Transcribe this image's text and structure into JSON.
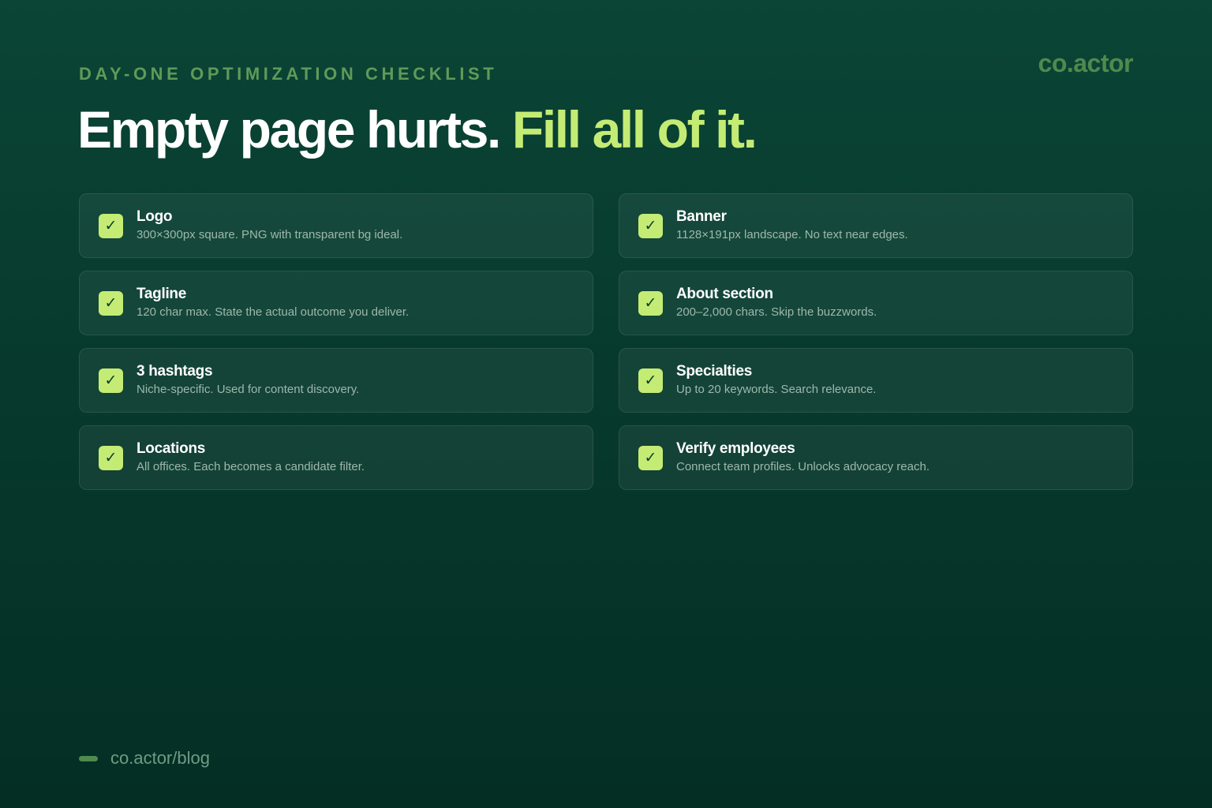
{
  "header": {
    "eyebrow": "DAY-ONE OPTIMIZATION CHECKLIST",
    "brand": "co.actor",
    "headline_part1": "Empty page hurts.",
    "headline_part2": "Fill all of it."
  },
  "check_glyph": "✓",
  "items": [
    {
      "title": "Logo",
      "desc": "300×300px square. PNG with transparent bg ideal."
    },
    {
      "title": "Banner",
      "desc": "1128×191px landscape. No text near edges."
    },
    {
      "title": "Tagline",
      "desc": "120 char max. State the actual outcome you deliver."
    },
    {
      "title": "About section",
      "desc": "200–2,000 chars. Skip the buzzwords."
    },
    {
      "title": "3 hashtags",
      "desc": "Niche-specific. Used for content discovery."
    },
    {
      "title": "Specialties",
      "desc": "Up to 20 keywords. Search relevance."
    },
    {
      "title": "Locations",
      "desc": "All offices. Each becomes a candidate filter."
    },
    {
      "title": "Verify employees",
      "desc": "Connect team profiles. Unlocks advocacy reach."
    }
  ],
  "footer": {
    "link": "co.actor/blog"
  },
  "colors": {
    "accent": "#c4ec74",
    "background": "#073a2d",
    "muted_green": "#5f9a59"
  }
}
